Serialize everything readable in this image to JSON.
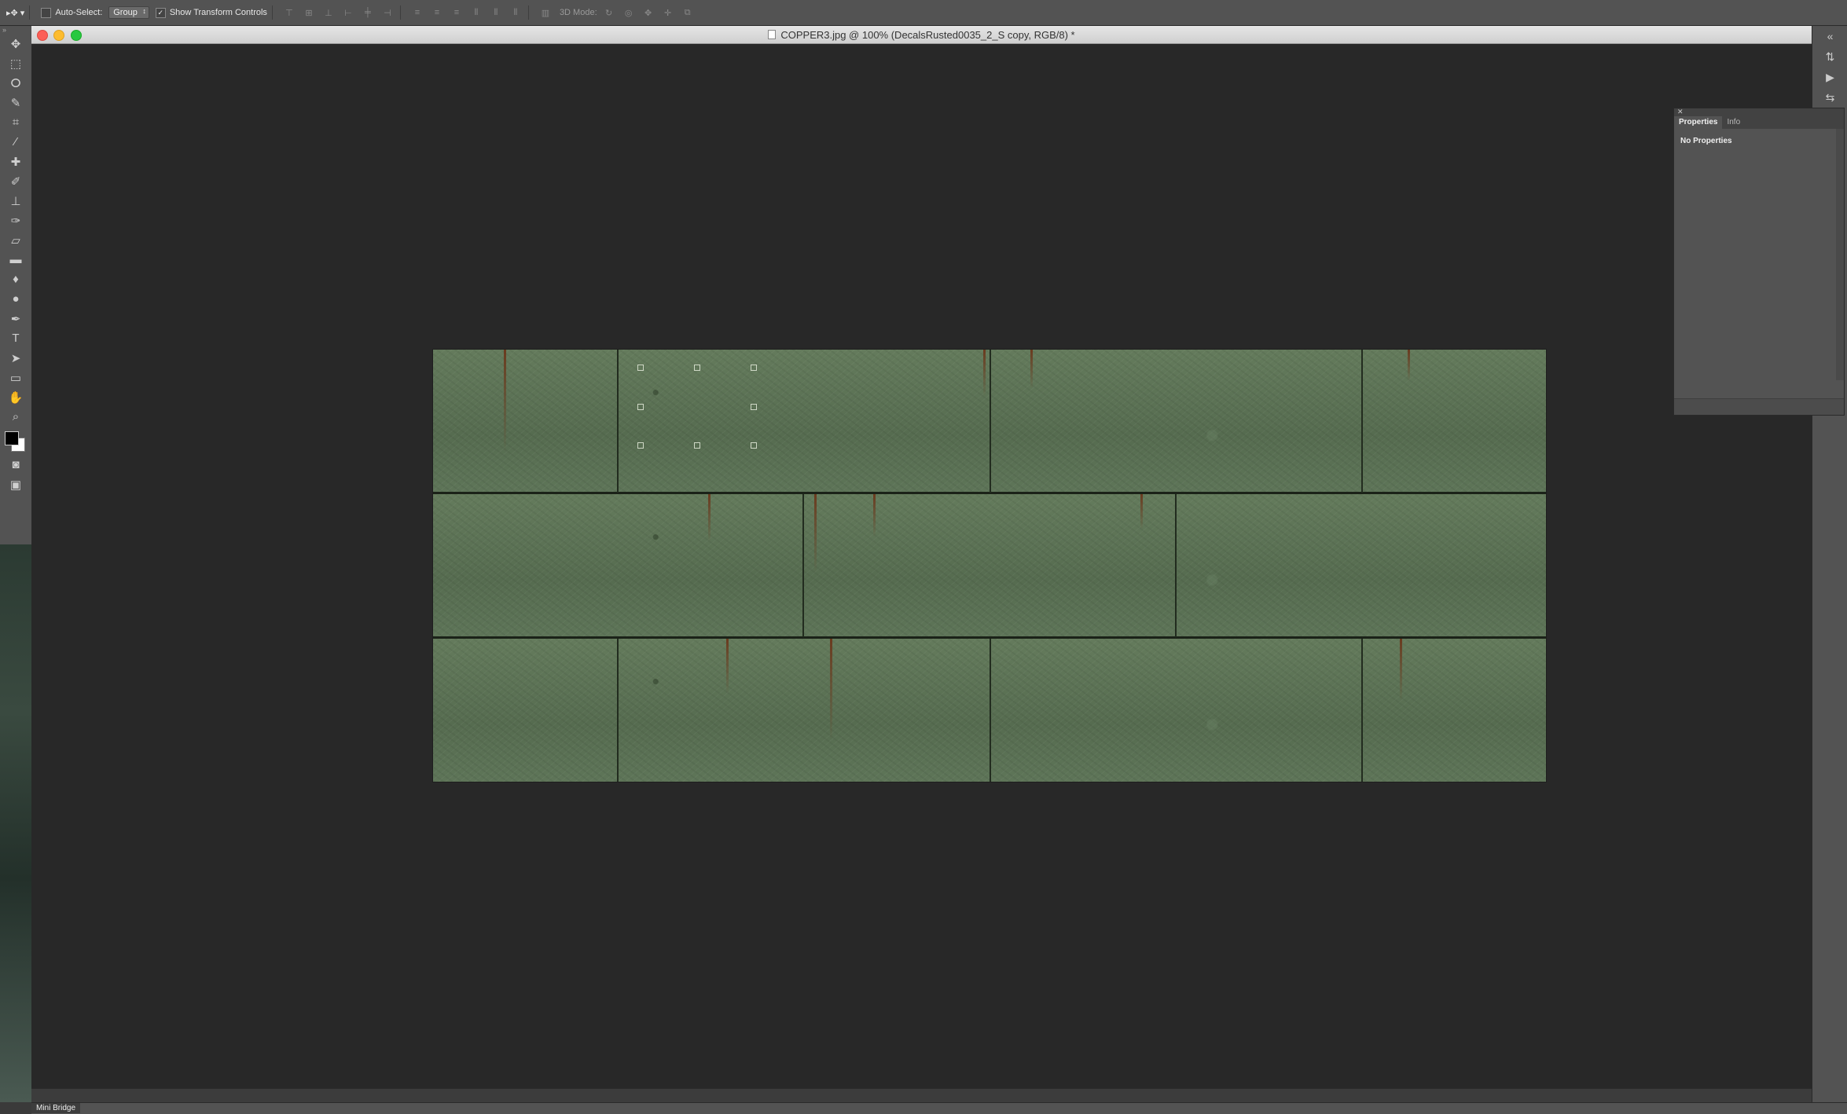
{
  "options_bar": {
    "auto_select_label": "Auto-Select:",
    "auto_select_value": "Group",
    "show_transform_label": "Show Transform Controls",
    "show_transform_checked": "✓",
    "mode_label": "3D Mode:"
  },
  "document": {
    "title": "COPPER3.jpg @ 100% (DecalsRusted0035_2_S copy, RGB/8) *"
  },
  "properties_panel": {
    "tabs": [
      "Properties",
      "Info"
    ],
    "body_text": "No Properties"
  },
  "bottom": {
    "mini_bridge_label": "Mini Bridge"
  },
  "colors": {
    "foreground": "#000000",
    "background": "#ffffff",
    "workspace": "#282828",
    "chrome": "#535353"
  },
  "icons": {
    "tools": [
      "move-tool-icon",
      "marquee-tool-icon",
      "lasso-tool-icon",
      "quick-select-tool-icon",
      "crop-tool-icon",
      "eyedropper-tool-icon",
      "healing-brush-tool-icon",
      "brush-tool-icon",
      "clone-stamp-tool-icon",
      "history-brush-tool-icon",
      "eraser-tool-icon",
      "gradient-tool-icon",
      "blur-tool-icon",
      "dodge-tool-icon",
      "pen-tool-icon",
      "type-tool-icon",
      "path-select-tool-icon",
      "rectangle-tool-icon",
      "hand-tool-icon",
      "zoom-tool-icon"
    ]
  }
}
